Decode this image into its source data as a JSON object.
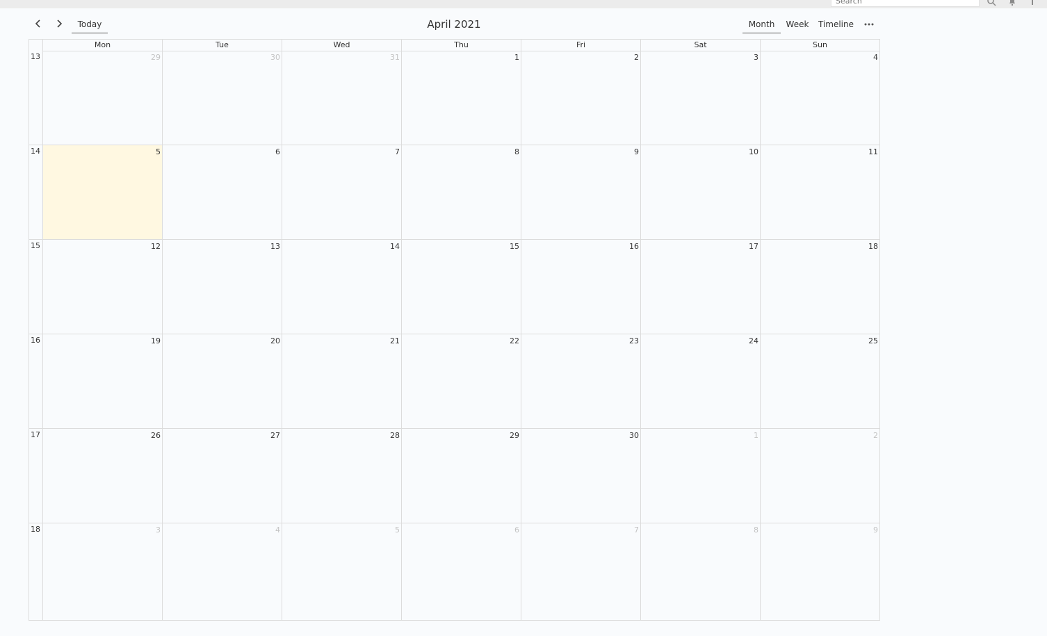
{
  "search": {
    "placeholder": "Search"
  },
  "toolbar": {
    "today_label": "Today",
    "title": "April 2021",
    "views": [
      {
        "label": "Month",
        "active": true
      },
      {
        "label": "Week",
        "active": false
      },
      {
        "label": "Timeline",
        "active": false
      }
    ],
    "more_icon": "more-horizontal-icon"
  },
  "weekdays": [
    "Mon",
    "Tue",
    "Wed",
    "Thu",
    "Fri",
    "Sat",
    "Sun"
  ],
  "weeks": [
    {
      "week": "13",
      "days": [
        {
          "num": "29",
          "other": true
        },
        {
          "num": "30",
          "other": true
        },
        {
          "num": "31",
          "other": true
        },
        {
          "num": "1"
        },
        {
          "num": "2"
        },
        {
          "num": "3"
        },
        {
          "num": "4"
        }
      ]
    },
    {
      "week": "14",
      "days": [
        {
          "num": "5",
          "today": true
        },
        {
          "num": "6"
        },
        {
          "num": "7"
        },
        {
          "num": "8"
        },
        {
          "num": "9"
        },
        {
          "num": "10"
        },
        {
          "num": "11"
        }
      ]
    },
    {
      "week": "15",
      "days": [
        {
          "num": "12"
        },
        {
          "num": "13"
        },
        {
          "num": "14"
        },
        {
          "num": "15"
        },
        {
          "num": "16"
        },
        {
          "num": "17"
        },
        {
          "num": "18"
        }
      ]
    },
    {
      "week": "16",
      "days": [
        {
          "num": "19"
        },
        {
          "num": "20"
        },
        {
          "num": "21"
        },
        {
          "num": "22"
        },
        {
          "num": "23"
        },
        {
          "num": "24"
        },
        {
          "num": "25"
        }
      ]
    },
    {
      "week": "17",
      "days": [
        {
          "num": "26"
        },
        {
          "num": "27"
        },
        {
          "num": "28"
        },
        {
          "num": "29"
        },
        {
          "num": "30"
        },
        {
          "num": "1",
          "other": true
        },
        {
          "num": "2",
          "other": true
        }
      ]
    },
    {
      "week": "18",
      "days": [
        {
          "num": "3",
          "other": true
        },
        {
          "num": "4",
          "other": true
        },
        {
          "num": "5",
          "other": true
        },
        {
          "num": "6",
          "other": true
        },
        {
          "num": "7",
          "other": true
        },
        {
          "num": "8",
          "other": true
        },
        {
          "num": "9",
          "other": true
        }
      ]
    }
  ],
  "colors": {
    "today_bg": "#fff8e1",
    "other_month_text": "#c3c3c3",
    "grid": "#dcdcdc"
  }
}
